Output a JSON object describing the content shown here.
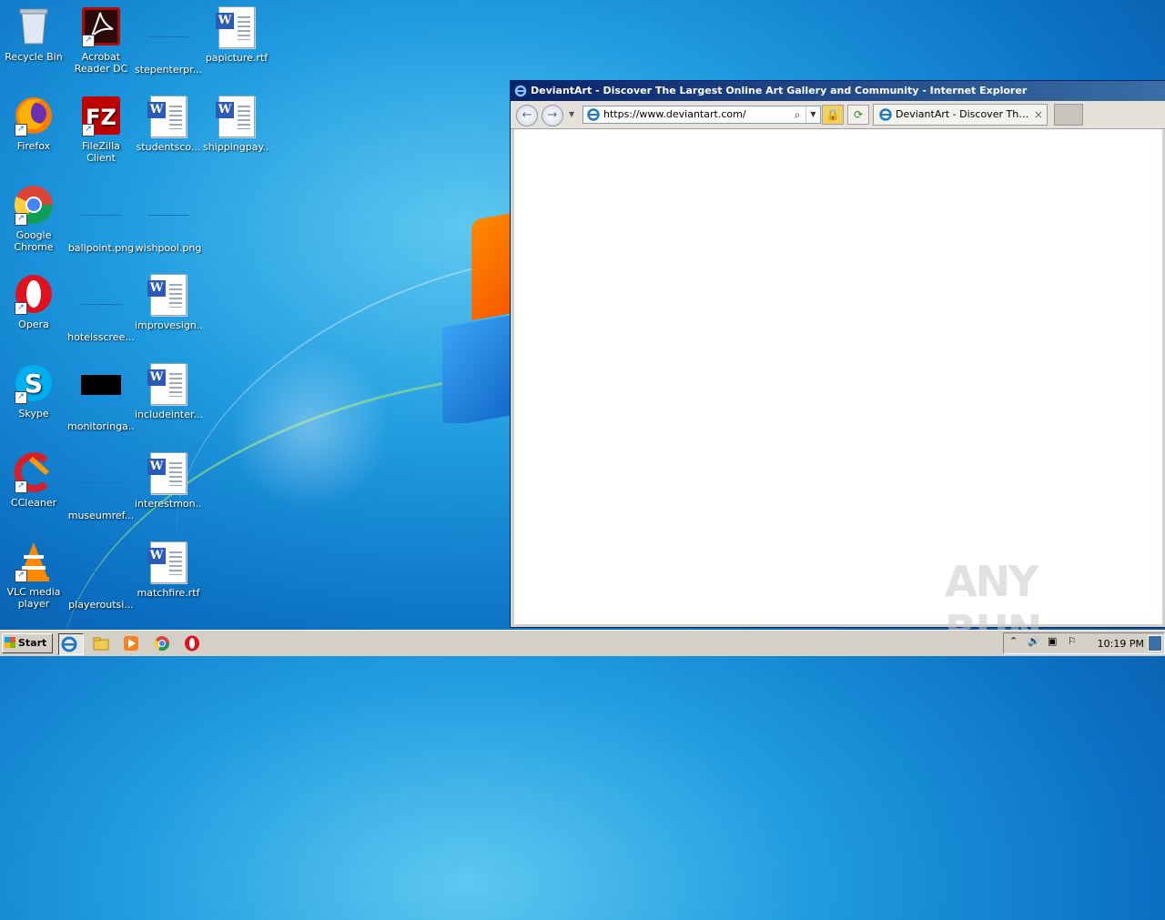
{
  "desktop": {
    "icons": [
      {
        "label": "Recycle Bin",
        "icon": "recycle-bin-icon"
      },
      {
        "label": "Acrobat Reader DC",
        "icon": "acrobat-icon"
      },
      {
        "label": "stepenterpr...",
        "icon": "image-file-icon"
      },
      {
        "label": "papicture.rtf",
        "icon": "word-document-icon"
      },
      {
        "label": "Firefox",
        "icon": "firefox-icon"
      },
      {
        "label": "FileZilla Client",
        "icon": "filezilla-icon"
      },
      {
        "label": "studentsco...",
        "icon": "word-document-icon"
      },
      {
        "label": "shippingpay...",
        "icon": "word-document-icon"
      },
      {
        "label": "Google Chrome",
        "icon": "chrome-icon"
      },
      {
        "label": "ballpoint.png",
        "icon": "image-file-icon"
      },
      {
        "label": "wishpool.png",
        "icon": "image-file-icon"
      },
      {
        "label": "Opera",
        "icon": "opera-icon"
      },
      {
        "label": "hotelsscree...",
        "icon": "image-file-icon"
      },
      {
        "label": "improvesign...",
        "icon": "word-document-icon"
      },
      {
        "label": "Skype",
        "icon": "skype-icon"
      },
      {
        "label": "monitoringa...",
        "icon": "image-file-icon"
      },
      {
        "label": "includeinter...",
        "icon": "word-document-icon"
      },
      {
        "label": "CCleaner",
        "icon": "ccleaner-icon"
      },
      {
        "label": "museumref...",
        "icon": "image-file-icon"
      },
      {
        "label": "interestmon...",
        "icon": "word-document-icon"
      },
      {
        "label": "VLC media player",
        "icon": "vlc-icon"
      },
      {
        "label": "playeroutsi...",
        "icon": "image-file-icon"
      },
      {
        "label": "matchfire.rtf",
        "icon": "word-document-icon"
      }
    ]
  },
  "browser": {
    "title": "DeviantArt - Discover The Largest Online Art Gallery and Community - Internet Explorer",
    "address": "https://www.deviantart.com/",
    "tab_title": "DeviantArt - Discover The La...",
    "close_glyph": "×"
  },
  "watermark": "ANY RUN",
  "taskbar": {
    "start_label": "Start",
    "clock": "10:19 PM"
  },
  "colors": {
    "ie_blue": "#1e78c8",
    "title_bar": "#0a246a"
  }
}
